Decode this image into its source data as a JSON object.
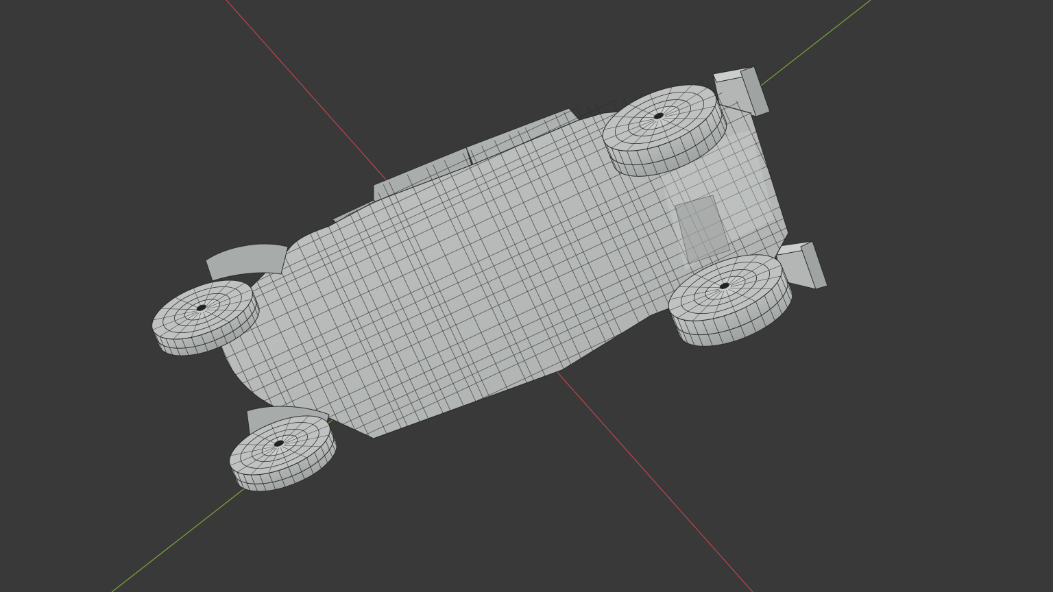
{
  "viewport": {
    "background": "#393939",
    "mode": "wireframe-overlay",
    "axes": {
      "x_axis_color": "#c2454d",
      "y_axis_color": "#7ba83a"
    },
    "object": {
      "type": "vehicle-model",
      "surface_color": "#b9bcba",
      "shadow_color": "#8d918f",
      "highlight_color": "#d3d6d4",
      "wire_color": "#2a2d2c"
    }
  }
}
